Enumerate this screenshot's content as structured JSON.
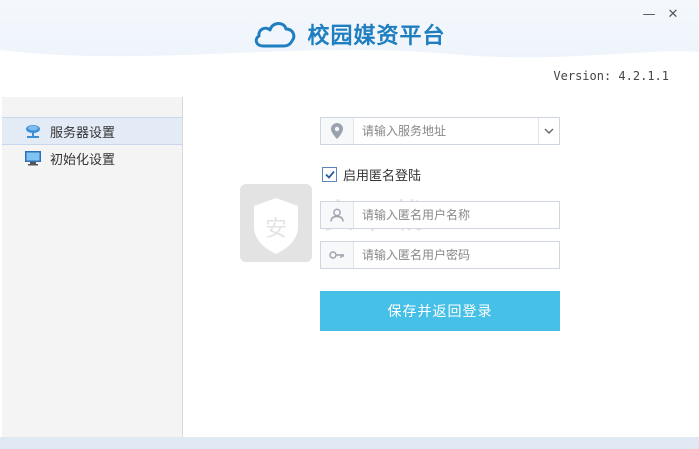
{
  "app": {
    "title": "校园媒资平台",
    "version": "Version: 4.2.1.1"
  },
  "window_controls": {
    "minimize": "—",
    "close": "✕"
  },
  "sidebar": {
    "items": [
      {
        "label": "服务器设置",
        "icon": "server-network-icon",
        "active": true
      },
      {
        "label": "初始化设置",
        "icon": "monitor-icon",
        "active": false
      }
    ]
  },
  "form": {
    "server_address": {
      "value": "",
      "placeholder": "请输入服务地址",
      "icon": "location-pin-icon"
    },
    "anonymous_login": {
      "label": "启用匿名登陆",
      "checked": true
    },
    "username": {
      "value": "",
      "placeholder": "请输入匿名用户名称",
      "icon": "user-icon"
    },
    "password": {
      "value": "",
      "placeholder": "请输入匿名用户密码",
      "icon": "key-icon"
    },
    "save_button": "保存并返回登录"
  },
  "colors": {
    "brand": "#1e7ec0",
    "button": "#46c0e6",
    "sidebar_active": "#e3ebf6"
  }
}
